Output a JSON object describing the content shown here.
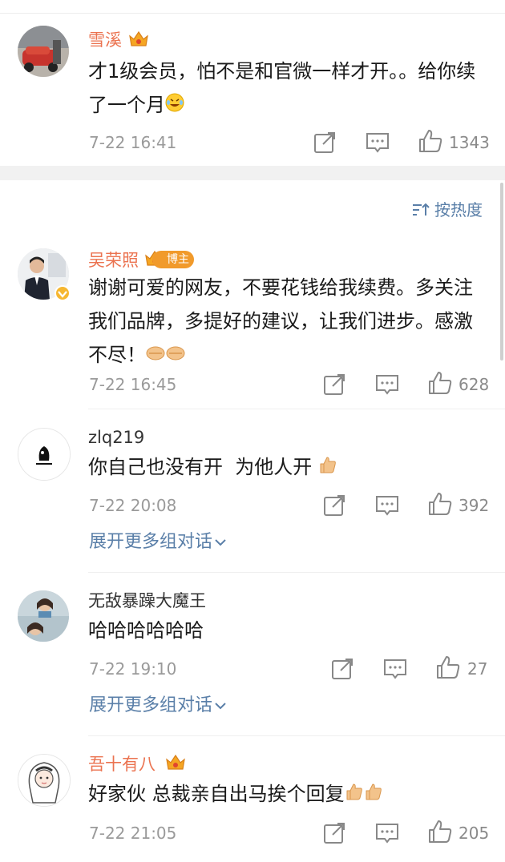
{
  "sort_label": "按热度",
  "comments": [
    {
      "user": "雪溪",
      "text": "才1级会员，怕不是和官微一样才开。。给你续了一个月",
      "time": "7-22 16:41",
      "likes": "1343"
    },
    {
      "user": "吴荣照",
      "badge": "博主",
      "text": "谢谢可爱的网友，不要花钱给我续费。多关注我们品牌，多提好的建议，让我们进步。感激不尽！",
      "time": "7-22 16:45",
      "likes": "628"
    },
    {
      "user": "zlq219",
      "text": "你自己也没有开  为他人开",
      "time": "7-22 20:08",
      "likes": "392",
      "expand": "展开更多组对话"
    },
    {
      "user": "无敌暴躁大魔王",
      "text": "哈哈哈哈哈哈",
      "time": "7-22 19:10",
      "likes": "27",
      "expand": "展开更多组对话"
    },
    {
      "user": "吾十有八",
      "text": "好家伙 总裁亲自出马挨个回复",
      "time": "7-22 21:05",
      "likes": "205"
    }
  ]
}
